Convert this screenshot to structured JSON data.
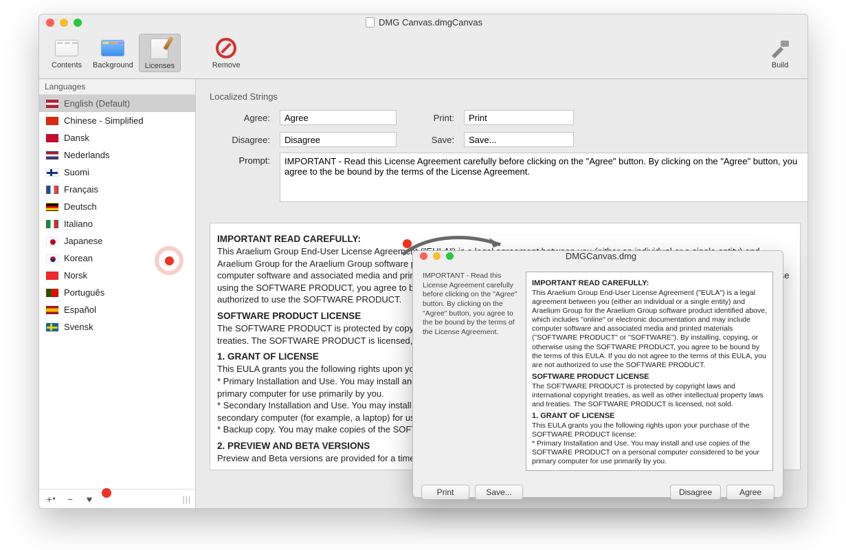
{
  "window": {
    "title": "DMG Canvas.dmgCanvas"
  },
  "toolbar": {
    "contents": "Contents",
    "background": "Background",
    "licenses": "Licenses",
    "remove": "Remove",
    "build": "Build"
  },
  "sidebar": {
    "header": "Languages",
    "items": [
      {
        "label": "English (Default)",
        "flag": "us",
        "selected": true
      },
      {
        "label": "Chinese - Simplified",
        "flag": "cn"
      },
      {
        "label": "Dansk",
        "flag": "dk"
      },
      {
        "label": "Nederlands",
        "flag": "nl"
      },
      {
        "label": "Suomi",
        "flag": "fi"
      },
      {
        "label": "Français",
        "flag": "fr"
      },
      {
        "label": "Deutsch",
        "flag": "de"
      },
      {
        "label": "Italiano",
        "flag": "it"
      },
      {
        "label": "Japanese",
        "flag": "jp"
      },
      {
        "label": "Korean",
        "flag": "kr"
      },
      {
        "label": "Norsk",
        "flag": "no"
      },
      {
        "label": "Português",
        "flag": "pt"
      },
      {
        "label": "Español",
        "flag": "es"
      },
      {
        "label": "Svensk",
        "flag": "se"
      }
    ]
  },
  "strings": {
    "section_label": "Localized Strings",
    "labels": {
      "agree": "Agree:",
      "disagree": "Disagree:",
      "print": "Print:",
      "save": "Save:",
      "prompt": "Prompt:"
    },
    "values": {
      "agree": "Agree",
      "disagree": "Disagree",
      "print": "Print",
      "save": "Save...",
      "prompt": "IMPORTANT - Read this License Agreement carefully before clicking on the \"Agree\" button. By clicking on the \"Agree\" button, you agree to the be bound by the terms of the License Agreement."
    }
  },
  "license": {
    "h1": "IMPORTANT READ CAREFULLY:",
    "p1": "This Araelium Group End-User License Agreement (\"EULA\") is a legal agreement between you (either an individual or a single entity) and Araelium Group for the Araelium Group software product identified above, which includes \"online\" or electronic documentation and may include computer software and associated media and printed materials (\"SOFTWARE PRODUCT\" or \"SOFTWARE\"). By installing, copying, or otherwise using the SOFTWARE PRODUCT, you agree to be bound by the terms of this EULA. If you do not agree to the terms of this EULA, you are not authorized to use the SOFTWARE PRODUCT.",
    "h2": "SOFTWARE PRODUCT LICENSE",
    "p2": "The SOFTWARE PRODUCT is protected by copyright laws and international copyright treaties, as well as other intellectual property laws and treaties. The SOFTWARE PRODUCT is licensed, not sold.",
    "h3": "1. GRANT OF LICENSE",
    "p3a": "This EULA grants you the following rights upon your purchase of the SOFTWARE PRODUCT license:",
    "p3b": "* Primary Installation and Use. You may install and use copies of the SOFTWARE PRODUCT on a personal computer considered to be your primary computer for use primarily by you.",
    "p3c": "* Secondary Installation and Use. You may install and use copies of the SOFTWARE PRODUCT on a personal computer considered to be your secondary computer (for example, a laptop) for use primarily be by you.",
    "p3d": "* Backup copy. You may make copies of the SOFTWARE PRODUCT as necessary for backup and archival purposes.",
    "h4": "2. PREVIEW AND BETA VERSIONS",
    "p4": "Preview and Beta versions are provided for a time-limited evaluation period."
  },
  "preview": {
    "title": "DMGCanvas.dmg",
    "left_prompt": "IMPORTANT - Read this License Agreement carefully before clicking on the \"Agree\" button. By clicking on the \"Agree\" button, you agree to the be bound by the terms of the License Agreement.",
    "buttons": {
      "print": "Print",
      "save": "Save...",
      "disagree": "Disagree",
      "agree": "Agree"
    }
  }
}
